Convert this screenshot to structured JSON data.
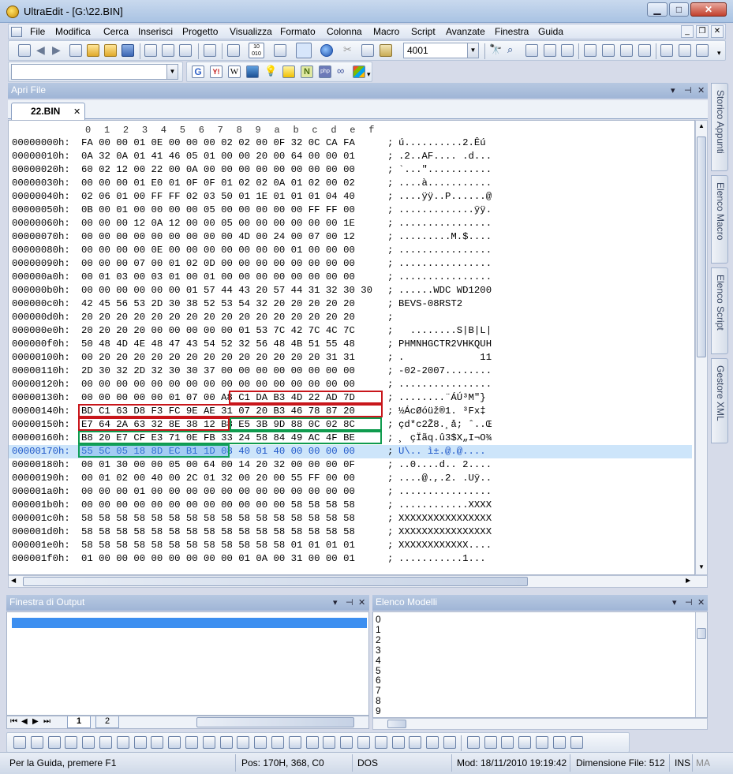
{
  "app": {
    "title": "UltraEdit - [G:\\22.BIN]"
  },
  "window_buttons": {
    "minimize": "▁",
    "maximize": "□",
    "close": "✕"
  },
  "menu": [
    "File",
    "Modifica",
    "Cerca",
    "Inserisci",
    "Progetto",
    "Visualizza",
    "Formato",
    "Colonna",
    "Macro",
    "Script",
    "Avanzate",
    "Finestra",
    "Guida"
  ],
  "toolbar": {
    "font_size_value": "4001",
    "search_combo_value": ""
  },
  "panels": {
    "open_files_title": "Apri File",
    "output_title": "Finestra di Output",
    "models_title": "Elenco Modelli"
  },
  "tab": {
    "label": "22.BIN",
    "close": "✕"
  },
  "side_tabs": [
    "Storico Appunti",
    "Elenco Macro",
    "Elenco Script",
    "Gestore XML"
  ],
  "ruler": [
    "0",
    "1",
    "2",
    "3",
    "4",
    "5",
    "6",
    "7",
    "8",
    "9",
    "a",
    "b",
    "c",
    "d",
    "e",
    "f"
  ],
  "hex_rows": [
    {
      "addr": "00000000h:",
      "bytes": "FA 00 00 01 0E 00 00 00 02 02 00 0F 32 0C CA FA",
      "ascii": "ú..........2.Êú"
    },
    {
      "addr": "00000010h:",
      "bytes": "0A 32 0A 01 41 46 05 01 00 00 20 00 64 00 00 01",
      "ascii": ".2..AF.... .d..."
    },
    {
      "addr": "00000020h:",
      "bytes": "60 02 12 00 22 00 0A 00 00 00 00 00 00 00 00 00",
      "ascii": "`...\"..........."
    },
    {
      "addr": "00000030h:",
      "bytes": "00 00 00 01 E0 01 0F 0F 01 02 02 0A 01 02 00 02",
      "ascii": "....à..........."
    },
    {
      "addr": "00000040h:",
      "bytes": "02 06 01 00 FF FF 02 03 50 01 1E 01 01 01 04 40",
      "ascii": "....ÿÿ..P......@"
    },
    {
      "addr": "00000050h:",
      "bytes": "0B 00 01 00 00 00 00 05 00 00 00 00 00 FF FF 00",
      "ascii": ".............ÿÿ."
    },
    {
      "addr": "00000060h:",
      "bytes": "00 00 00 12 0A 12 00 00 05 00 00 00 00 00 00 1E",
      "ascii": "................"
    },
    {
      "addr": "00000070h:",
      "bytes": "00 00 00 00 00 00 00 00 00 4D 00 24 00 07 00 12",
      "ascii": ".........M.$...."
    },
    {
      "addr": "00000080h:",
      "bytes": "00 00 00 00 0E 00 00 00 00 00 00 00 01 00 00 00",
      "ascii": "................"
    },
    {
      "addr": "00000090h:",
      "bytes": "00 00 00 07 00 01 02 0D 00 00 00 00 00 00 00 00",
      "ascii": "................"
    },
    {
      "addr": "000000a0h:",
      "bytes": "00 01 03 00 03 01 00 01 00 00 00 00 00 00 00 00",
      "ascii": "................"
    },
    {
      "addr": "000000b0h:",
      "bytes": "00 00 00 00 00 00 01 57 44 43 20 57 44 31 32 30 30",
      "ascii": "......WDC WD1200"
    },
    {
      "addr": "000000c0h:",
      "bytes": "42 45 56 53 2D 30 38 52 53 54 32 20 20 20 20 20",
      "ascii": "BEVS-08RST2"
    },
    {
      "addr": "000000d0h:",
      "bytes": "20 20 20 20 20 20 20 20 20 20 20 20 20 20 20 20",
      "ascii": ""
    },
    {
      "addr": "000000e0h:",
      "bytes": "20 20 20 20 00 00 00 00 00 01 53 7C 42 7C 4C 7C",
      "ascii": "  ........S|B|L|"
    },
    {
      "addr": "000000f0h:",
      "bytes": "50 48 4D 4E 48 47 43 54 52 32 56 48 4B 51 55 48",
      "ascii": "PHMNHGCTR2VHKQUH"
    },
    {
      "addr": "00000100h:",
      "bytes": "00 20 20 20 20 20 20 20 20 20 20 20 20 20 31 31",
      "ascii": ".             11"
    },
    {
      "addr": "00000110h:",
      "bytes": "2D 30 32 2D 32 30 30 37 00 00 00 00 00 00 00 00",
      "ascii": "-02-2007........"
    },
    {
      "addr": "00000120h:",
      "bytes": "00 00 00 00 00 00 00 00 00 00 00 00 00 00 00 00",
      "ascii": "................"
    },
    {
      "addr": "00000130h:",
      "bytes": "00 00 00 00 00 01 07 00 A8 C1 DA B3 4D 22 AD 7D",
      "ascii": "........¨ÁÚ³M\"­}"
    },
    {
      "addr": "00000140h:",
      "bytes": "BD C1 63 D8 F3 FC 9E AE 31 07 20 B3 46 78 87 20",
      "ascii": "½ÁcØóüž®1. ³Fx‡"
    },
    {
      "addr": "00000150h:",
      "bytes": "E7 64 2A 63 32 8E 38 12 B8 E5 3B 9D 88 0C 02 8C",
      "ascii": "çd*c2Ž8.¸å; ˆ..Œ"
    },
    {
      "addr": "00000160h:",
      "bytes": "B8 20 E7 CF E3 71 0E FB 33 24 58 84 49 AC 4F BE",
      "ascii": "¸ çÏãq.û3$X„I¬O¾"
    },
    {
      "addr": "00000170h:",
      "bytes": "55 5C 05 18 8D EC B1 1D 08 40 01 40 00 00 00 00",
      "ascii": "U\\.. ì±.@.@...."
    },
    {
      "addr": "00000180h:",
      "bytes": "00 01 30 00 00 05 00 64 00 14 20 32 00 00 00 0F",
      "ascii": "..0....d.. 2...."
    },
    {
      "addr": "00000190h:",
      "bytes": "00 01 02 00 40 00 2C 01 32 00 20 00 55 FF 00 00",
      "ascii": "....@.,.2. .Uÿ.."
    },
    {
      "addr": "000001a0h:",
      "bytes": "00 00 00 01 00 00 00 00 00 00 00 00 00 00 00 00",
      "ascii": "................"
    },
    {
      "addr": "000001b0h:",
      "bytes": "00 00 00 00 00 00 00 00 00 00 00 00 58 58 58 58",
      "ascii": "............XXXX"
    },
    {
      "addr": "000001c0h:",
      "bytes": "58 58 58 58 58 58 58 58 58 58 58 58 58 58 58 58",
      "ascii": "XXXXXXXXXXXXXXXX"
    },
    {
      "addr": "000001d0h:",
      "bytes": "58 58 58 58 58 58 58 58 58 58 58 58 58 58 58 58",
      "ascii": "XXXXXXXXXXXXXXXX"
    },
    {
      "addr": "000001e0h:",
      "bytes": "58 58 58 58 58 58 58 58 58 58 58 58 01 01 01 01",
      "ascii": "XXXXXXXXXXXX...."
    },
    {
      "addr": "000001f0h:",
      "bytes": "01 00 00 00 00 00 00 00 00 01 0A 00 31 00 00 01",
      "ascii": "...........1..."
    }
  ],
  "output_tabs": [
    "1",
    "2"
  ],
  "models_list": [
    "0",
    "1",
    "2",
    "3",
    "4",
    "5",
    "6",
    "7",
    "8",
    "9"
  ],
  "status": {
    "help": "Per la Guida, premere F1",
    "position": "Pos: 170H, 368, C0",
    "line_ending": "DOS",
    "modified": "Mod: 18/11/2010 19:19:42",
    "file_size": "Dimensione File: 512",
    "insert": "INS",
    "caps": "MA"
  },
  "colors": {
    "highlight_red": "#c8161b",
    "highlight_green": "#0f9b4e",
    "selection": "#cde5fa"
  }
}
